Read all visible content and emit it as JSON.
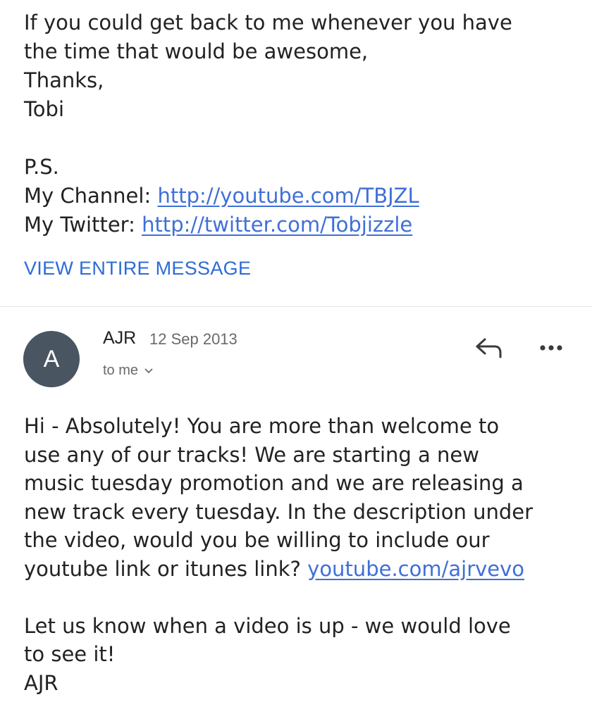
{
  "quoted": {
    "lines": [
      "If you could get back to me whenever you have",
      "the time that would be awesome,",
      "Thanks,",
      "Tobi"
    ],
    "ps": "P.S.",
    "channel_label": "My Channel: ",
    "channel_link": "http://youtube.com/TBJZL",
    "twitter_label": "My Twitter: ",
    "twitter_link": "http://twitter.com/Tobjizzle"
  },
  "view_entire_label": "VIEW ENTIRE MESSAGE",
  "message": {
    "avatar_initial": "A",
    "sender": "AJR",
    "date": "12 Sep 2013",
    "recipient": "to me",
    "body_lines": [
      "Hi - Absolutely! You are more than welcome to",
      "use any of our tracks! We are starting a new",
      "music tuesday promotion and we are releasing a",
      "new track every tuesday. In the description under",
      "the video, would you be willing to include our"
    ],
    "link_line_prefix": "youtube link or itunes link? ",
    "link": "youtube.com/ajrvevo",
    "closing_lines": [
      "Let us know when a video is up - we would love",
      "to see it!",
      "AJR"
    ]
  },
  "colors": {
    "link": "#3f6fd8",
    "avatar_bg": "#4a5562",
    "divider": "#e6e6e6"
  },
  "icons": {
    "reply": "reply-icon",
    "more": "more-options-icon",
    "chevron": "chevron-down-icon"
  }
}
